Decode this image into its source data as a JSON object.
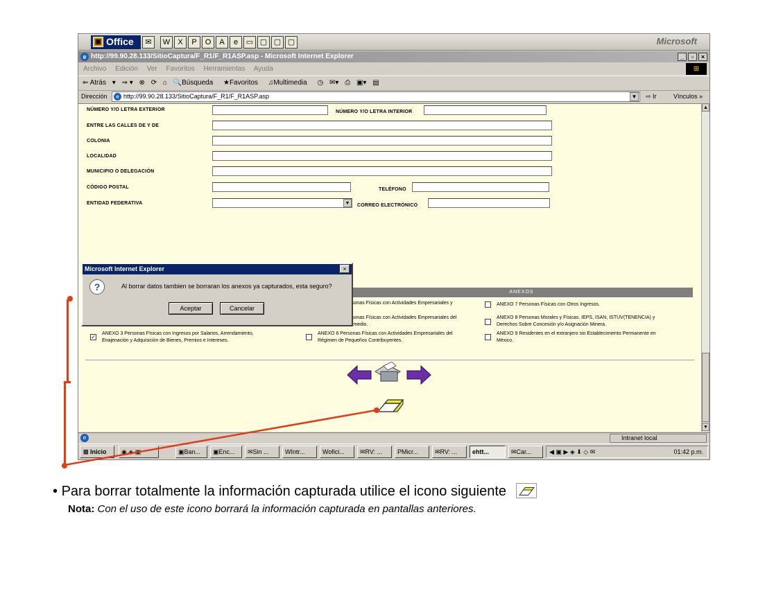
{
  "office_bar": {
    "title": "Office",
    "brand": "Microsoft"
  },
  "ie": {
    "title": "http://99.90.28.133/SitioCaptura/F_R1/F_R1ASP.asp - Microsoft Internet Explorer",
    "menu": [
      "Archivo",
      "Edición",
      "Ver",
      "Favoritos",
      "Herramientas",
      "Ayuda"
    ],
    "toolbar": {
      "back": "Atrás",
      "search": "Búsqueda",
      "favorites": "Favoritos",
      "multimedia": "Multimedia"
    },
    "address_label": "Dirección",
    "address_value": "http://99.90.28.133/SitioCaptura/F_R1/F_R1ASP.asp",
    "go_label": "Ir",
    "links_label": "Vínculos",
    "status_zone": "Intranet local"
  },
  "form": {
    "numero_exterior": "NÚMERO Y/O LETRA EXTERIOR",
    "numero_interior": "NÚMERO Y/O LETRA INTERIOR",
    "entre_calles": "ENTRE LAS CALLES DE Y DE",
    "colonia": "COLONIA",
    "localidad": "LOCALIDAD",
    "municipio": "MUNICIPIO O DELEGACIÓN",
    "codigo_postal": "CÓDIGO POSTAL",
    "telefono": "TELÉFONO",
    "entidad": "ENTIDAD FEDERATIVA",
    "correo": "CORREO ELECTRÓNICO"
  },
  "anexos": {
    "header": "ANEXOS",
    "items": [
      {
        "text1": "sonas Físicas con Actividades Empresariales y",
        "text2": "",
        "checked": false
      },
      {
        "text1": "ANEXO 7 Personas Físicas con Otros Ingresos.",
        "text2": "",
        "checked": false
      },
      {
        "text1": "sonas Físicas con Actividades Empresariales del",
        "text2": "rmedio.",
        "checked": false
      },
      {
        "text1": "ANEXO 8 Personas Morales y Físicas. IEPS, ISAN, ISTUV(TENENCIA) y",
        "text2": "Derechos Sobre Concesión y/o Asignación Minera.",
        "checked": false
      },
      {
        "text1": "ANEXO 3 Personas Físicas con Ingresos por Salarios, Arrendamiento,",
        "text2": "Enajenación y Adquisición de Bienes, Premios e Intereses.",
        "checked": true
      },
      {
        "text1": "ANEXO 6 Personas Físicas con Actividades Empresariales del",
        "text2": "Régimen de Pequeños Contribuyentes.",
        "checked": false
      },
      {
        "text1": "ANEXO 9 Residentes en el extranjero sin Establecimiento Permanente en",
        "text2": "México.",
        "checked": false
      }
    ]
  },
  "dialog": {
    "title": "Microsoft Internet Explorer",
    "message": "Al borrar datos tambien se borraran los anexos ya capturados, esta seguro?",
    "ok": "Aceptar",
    "cancel": "Cancelar"
  },
  "taskbar": {
    "start": "Inicio",
    "tasks": [
      "Ban...",
      "Enc...",
      "Sin ...",
      "Intr...",
      "ofici...",
      "RV: ...",
      "Micr...",
      "RV: ...",
      "htt...",
      "Car..."
    ],
    "clock": "01:42 p.m."
  },
  "caption": {
    "text": "Para borrar totalmente la información capturada utilice el icono siguiente",
    "note_label": "Nota:",
    "note_text": " Con el uso de este icono borrará la información capturada en pantallas anteriores."
  },
  "colors": {
    "annotation": "#e23c14",
    "form_bg": "#fffde0",
    "arrow": "#6b2fa6",
    "dialog_title": "#0a246a"
  }
}
